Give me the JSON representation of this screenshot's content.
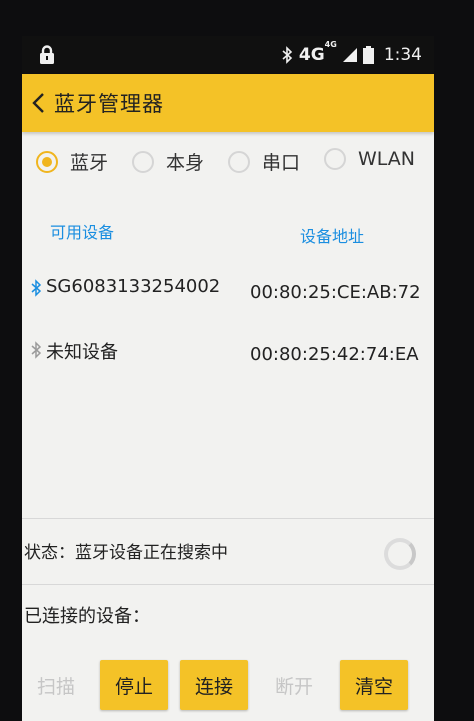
{
  "status_bar": {
    "network": "4G",
    "network_sup": "4G",
    "time": "1:34"
  },
  "app_bar": {
    "title": "蓝牙管理器"
  },
  "connection_types": [
    {
      "label": "蓝牙",
      "selected": true
    },
    {
      "label": "本身",
      "selected": false
    },
    {
      "label": "串口",
      "selected": false
    },
    {
      "label": "WLAN",
      "selected": false
    }
  ],
  "device_list": {
    "col_available": "可用设备",
    "col_address": "设备地址",
    "devices": [
      {
        "name": "SG6083133254002",
        "address": "00:80:25:CE:AB:72"
      },
      {
        "name": "未知设备",
        "address": "00:80:25:42:74:EA"
      }
    ]
  },
  "status": {
    "label": "状态：",
    "text": "蓝牙设备正在搜索中"
  },
  "connected": {
    "label": "已连接的设备："
  },
  "buttons": [
    {
      "label": "扫描",
      "enabled": false
    },
    {
      "label": "停止",
      "enabled": true
    },
    {
      "label": "连接",
      "enabled": true
    },
    {
      "label": "断开",
      "enabled": false
    },
    {
      "label": "清空",
      "enabled": true
    }
  ],
  "colors": {
    "accent": "#f4c227",
    "link": "#1a8ee0",
    "radio_checked": "#f0b51e"
  }
}
